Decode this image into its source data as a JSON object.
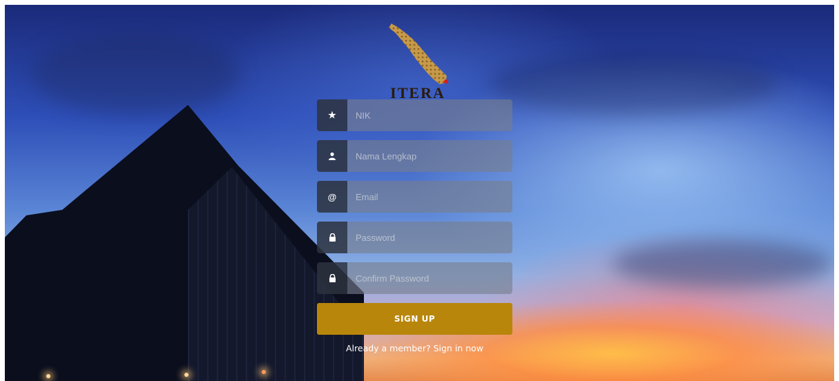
{
  "logo": {
    "text": "ITERA"
  },
  "form": {
    "fields": [
      {
        "icon": "★",
        "icon_name": "star-icon",
        "placeholder": "NIK"
      },
      {
        "icon": "👤",
        "icon_name": "user-icon",
        "placeholder": "Nama Lengkap"
      },
      {
        "icon": "@",
        "icon_name": "at-icon",
        "placeholder": "Email"
      },
      {
        "icon": "🔒",
        "icon_name": "lock-icon",
        "placeholder": "Password"
      },
      {
        "icon": "🔒",
        "icon_name": "lock-icon",
        "placeholder": "Confirm Password"
      }
    ],
    "submit_label": "SIGN UP",
    "member_text": "Already a member? Sign in now"
  },
  "colors": {
    "button": "#b8860b",
    "addon": "#2d323e"
  }
}
